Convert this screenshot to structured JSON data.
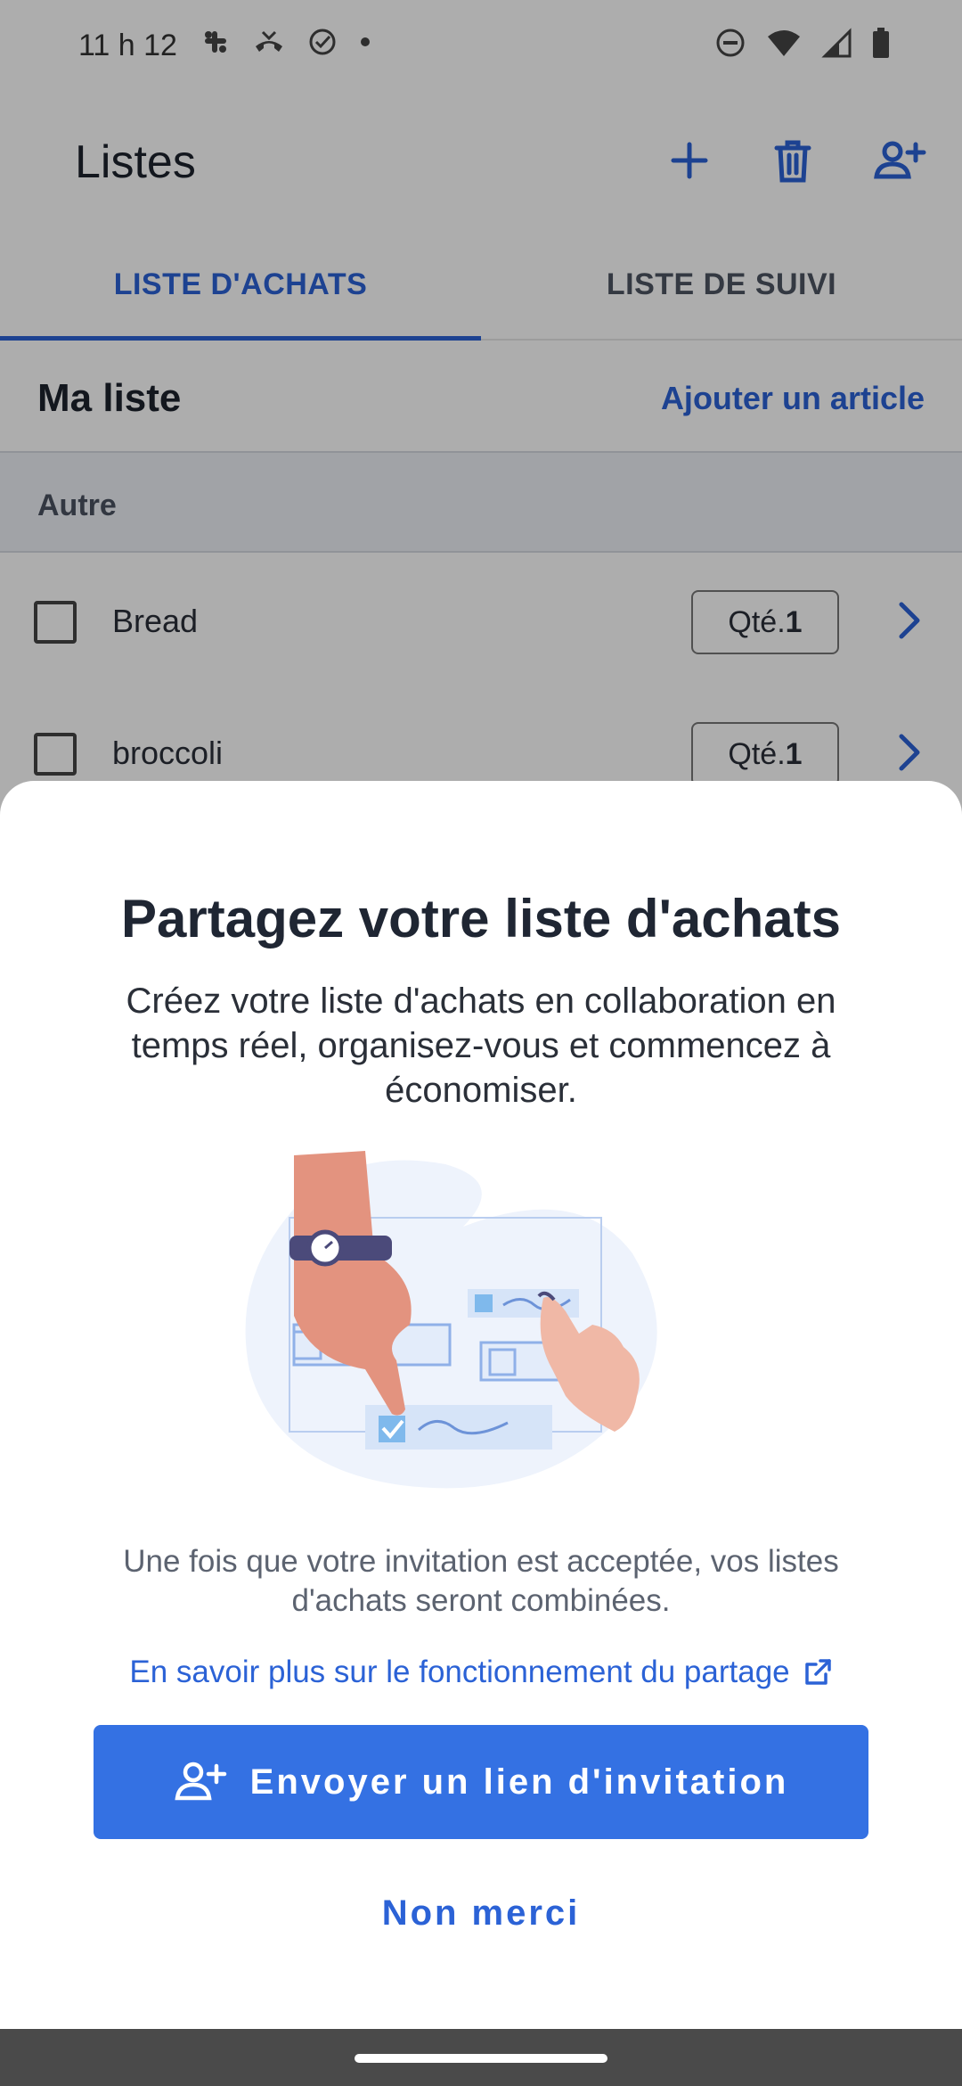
{
  "status_bar": {
    "time": "11 h 12"
  },
  "app_bar": {
    "title": "Listes"
  },
  "tabs": [
    {
      "label": "LISTE D'ACHATS",
      "active": true
    },
    {
      "label": "LISTE DE SUIVI",
      "active": false
    }
  ],
  "list": {
    "title": "Ma liste",
    "add_item_label": "Ajouter un article",
    "category": "Autre",
    "items": [
      {
        "name": "Bread",
        "qty_label": "Qté.",
        "qty": "1",
        "checked": false
      },
      {
        "name": "broccoli",
        "qty_label": "Qté.",
        "qty": "1",
        "checked": false
      }
    ]
  },
  "sheet": {
    "title": "Partagez votre liste d'achats",
    "description": "Créez votre liste d'achats en collaboration en temps réel, organisez-vous et commencez à économiser.",
    "note": "Une fois que votre invitation est acceptée, vos listes d'achats seront combinées.",
    "learn_more": "En savoir plus sur le fonctionnement du partage",
    "invite_button": "Envoyer un lien d'invitation",
    "dismiss": "Non merci"
  },
  "colors": {
    "accent": "#2b62d6",
    "button": "#3471e3",
    "scrim": "rgba(0,0,0,0.32)"
  },
  "icons": {
    "app_bar": [
      "add-icon",
      "trash-icon",
      "add-person-icon"
    ],
    "learn_more": "external-link-icon",
    "invite_button": "add-person-icon"
  }
}
